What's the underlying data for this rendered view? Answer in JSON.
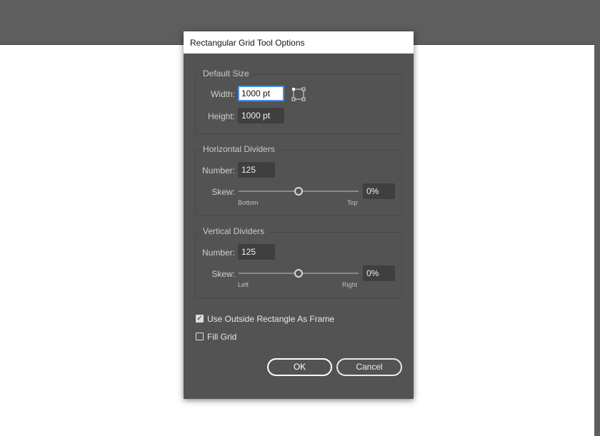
{
  "dialog": {
    "title": "Rectangular Grid Tool Options"
  },
  "default_size": {
    "legend": "Default Size",
    "width_label": "Width:",
    "width_value": "1000 pt",
    "height_label": "Height:",
    "height_value": "1000 pt"
  },
  "horizontal": {
    "legend": "Horizontal Dividers",
    "number_label": "Number:",
    "number_value": "125",
    "skew_label": "Skew:",
    "skew_value": "0%",
    "skew_min_label": "Bottom",
    "skew_max_label": "Top",
    "skew_position": 0.5
  },
  "vertical": {
    "legend": "Vertical Dividers",
    "number_label": "Number:",
    "number_value": "125",
    "skew_label": "Skew:",
    "skew_value": "0%",
    "skew_min_label": "Left",
    "skew_max_label": "Right",
    "skew_position": 0.5
  },
  "options": {
    "use_outside_label": "Use Outside Rectangle As Frame",
    "use_outside_checked": true,
    "fill_grid_label": "Fill Grid",
    "fill_grid_checked": false,
    "check_glyph": "✓"
  },
  "buttons": {
    "ok": "OK",
    "cancel": "Cancel"
  }
}
